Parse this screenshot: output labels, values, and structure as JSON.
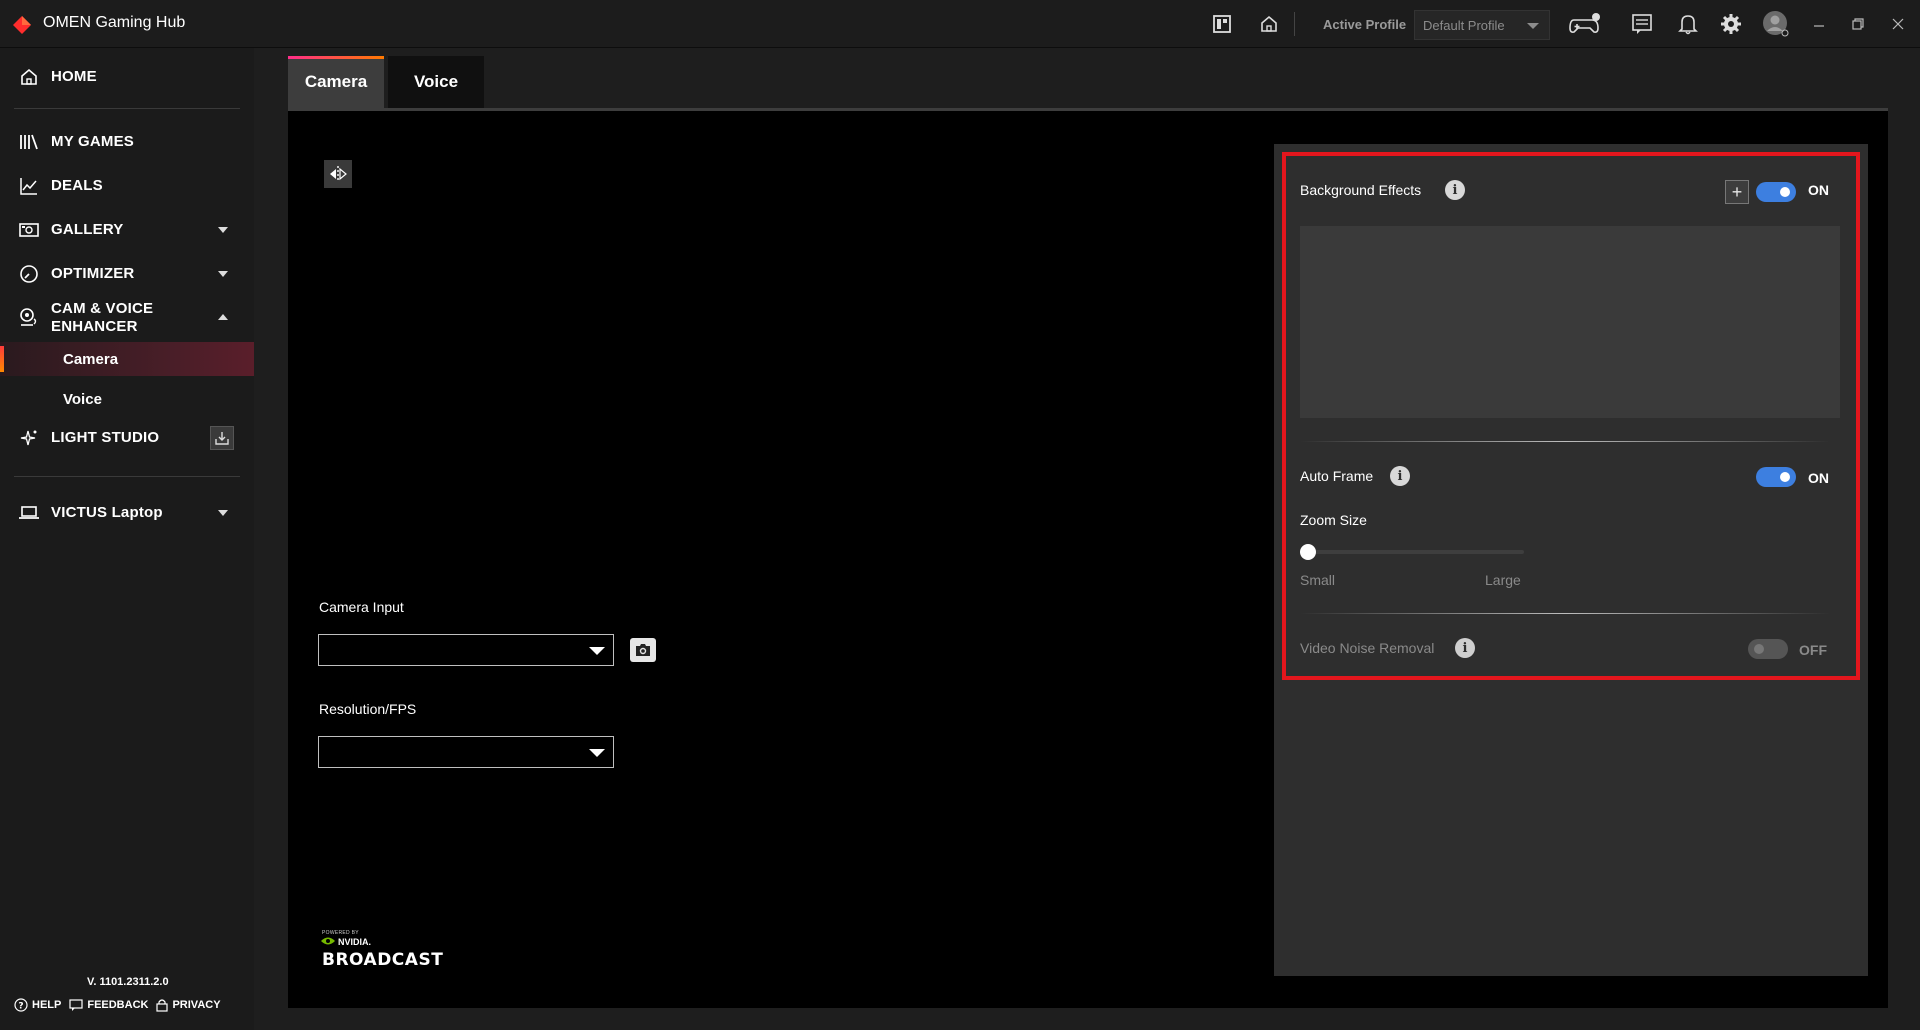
{
  "window": {
    "title": "OMEN Gaming Hub",
    "active_profile_label": "Active Profile",
    "profile_value": "Default Profile"
  },
  "sidebar": {
    "items": [
      {
        "label": "HOME",
        "icon": "home-icon"
      },
      {
        "label": "MY GAMES",
        "icon": "library-icon"
      },
      {
        "label": "DEALS",
        "icon": "chart-icon"
      },
      {
        "label": "GALLERY",
        "icon": "gallery-icon"
      },
      {
        "label": "OPTIMIZER",
        "icon": "gauge-icon"
      },
      {
        "label": "CAM & VOICE",
        "label2": "ENHANCER",
        "icon": "webcam-icon"
      },
      {
        "label": "LIGHT STUDIO",
        "icon": "sparkle-icon"
      },
      {
        "label": "VICTUS Laptop",
        "icon": "laptop-icon"
      }
    ],
    "subitems": [
      {
        "label": "Camera",
        "active": true
      },
      {
        "label": "Voice",
        "active": false
      }
    ],
    "version": "V. 1101.2311.2.0",
    "footer": {
      "help": "HELP",
      "feedback": "FEEDBACK",
      "privacy": "PRIVACY"
    }
  },
  "main": {
    "tabs": [
      {
        "label": "Camera",
        "active": true
      },
      {
        "label": "Voice",
        "active": false
      }
    ],
    "camera_input_label": "Camera Input",
    "camera_input_value": "",
    "resolution_label": "Resolution/FPS",
    "resolution_value": "",
    "nvidia": {
      "powered_by": "POWERED BY",
      "brand": "NVIDIA.",
      "product": "BROADCAST"
    }
  },
  "settings": {
    "background_effects": {
      "label": "Background Effects",
      "state": "ON",
      "enabled": true
    },
    "auto_frame": {
      "label": "Auto Frame",
      "state": "ON",
      "enabled": true
    },
    "zoom": {
      "label": "Zoom Size",
      "min_label": "Small",
      "max_label": "Large",
      "value": 0
    },
    "video_noise_removal": {
      "label": "Video Noise Removal",
      "state": "OFF",
      "enabled": false
    }
  },
  "colors": {
    "accent_blue": "#3d7fe0",
    "highlight_red": "#e3161d",
    "brand_red": "#ff2d2d"
  }
}
